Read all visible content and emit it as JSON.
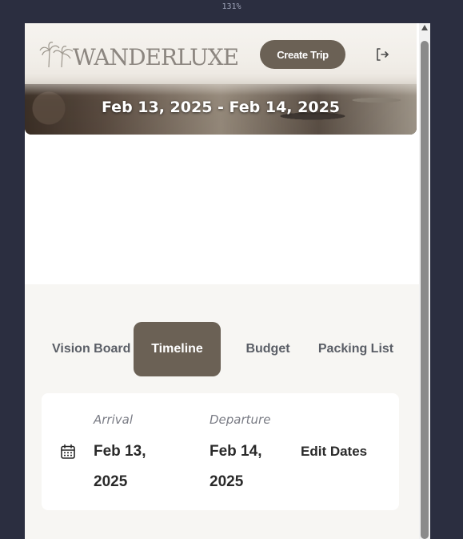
{
  "browser": {
    "zoom": "131%"
  },
  "header": {
    "logo_text": "WANDERLUXE",
    "create_trip_label": "Create Trip",
    "date_range": "Feb 13, 2025 - Feb 14, 2025"
  },
  "tabs": [
    {
      "label": "Vision Board",
      "active": false
    },
    {
      "label": "Timeline",
      "active": true
    },
    {
      "label": "Budget",
      "active": false
    },
    {
      "label": "Packing List",
      "active": false
    }
  ],
  "dates_card": {
    "arrival_label": "Arrival",
    "arrival_value": "Feb 13, 2025",
    "departure_label": "Departure",
    "departure_value": "Feb 14, 2025",
    "edit_label": "Edit Dates"
  },
  "colors": {
    "accent": "#6b6155",
    "page_bg": "#2b2e40",
    "content_bg": "#f7f6f3"
  },
  "icons": {
    "logo": "palm-trees-icon",
    "logout": "logout-icon",
    "calendar": "calendar-icon"
  }
}
